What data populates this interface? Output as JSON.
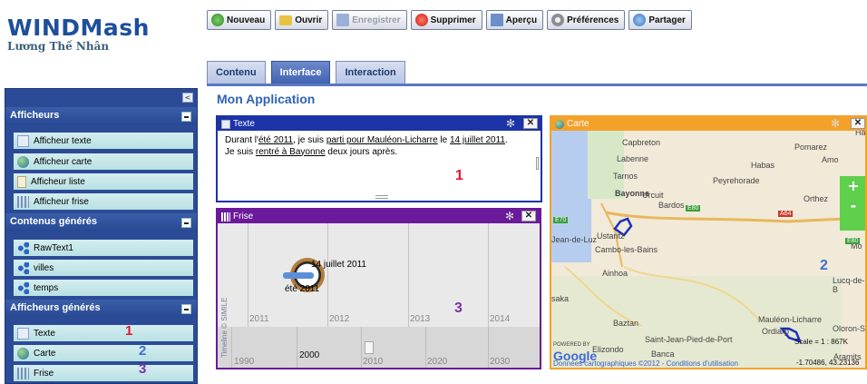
{
  "brand": {
    "title": "WINDMash",
    "author": "Lương Thế Nhân"
  },
  "toolbar": {
    "nouveau": "Nouveau",
    "ouvrir": "Ouvrir",
    "enregistrer": "Enregistrer",
    "supprimer": "Supprimer",
    "apercu": "Aperçu",
    "preferences": "Préférences",
    "partager": "Partager"
  },
  "tabs": [
    {
      "label": "Contenu"
    },
    {
      "label": "Interface"
    },
    {
      "label": "Interaction"
    }
  ],
  "sidebar": {
    "collapse_glyph": "<",
    "afficheurs": {
      "header": "Afficheurs",
      "items": [
        {
          "label": "Afficheur texte"
        },
        {
          "label": "Afficheur carte"
        },
        {
          "label": "Afficheur liste"
        },
        {
          "label": "Afficheur frise"
        }
      ]
    },
    "contenus": {
      "header": "Contenus générés",
      "items": [
        {
          "label": "RawText1"
        },
        {
          "label": "villes"
        },
        {
          "label": "temps"
        }
      ]
    },
    "generes": {
      "header": "Afficheurs générés",
      "items": [
        {
          "label": "Texte",
          "num": "1"
        },
        {
          "label": "Carte",
          "num": "2"
        },
        {
          "label": "Frise",
          "num": "3"
        }
      ]
    }
  },
  "main": {
    "title": "Mon Application"
  },
  "texte_panel": {
    "title": "Texte",
    "p1_a": "Durant l'",
    "p1_link1": "été 2011",
    "p1_b": ", je suis ",
    "p1_link2": "parti pour Mauléon-Licharre",
    "p1_c": " le ",
    "p1_link3": "14 juillet 2011",
    "p1_d": ".",
    "p2_a": "Je suis ",
    "p2_link": "rentré à Bayonne",
    "p2_b": " deux jours après.",
    "num": "1"
  },
  "frise_panel": {
    "title": "Frise",
    "event1": "14 juillet 2011",
    "event2": "été 2011",
    "years_top": [
      "2011",
      "2012",
      "2013",
      "2014"
    ],
    "years_bottom": [
      "1990",
      "2000",
      "2010",
      "2020",
      "2030"
    ],
    "credit": "Timeline © SIMILE",
    "num": "3"
  },
  "carte_panel": {
    "title": "Carte",
    "places": [
      "Capbreton",
      "Labenne",
      "Tarnos",
      "Bayonne",
      "Urcuit",
      "Bardos",
      "Habas",
      "Peyrehorade",
      "Pomarez",
      "Amo",
      "Ha",
      "Orthez",
      "Mo",
      "Ustaritz",
      "Cambo-les-Bains",
      "Jean-de-Luz",
      "Ainhoa",
      "saka",
      "Lucq-de-B",
      "Mauléon-Licharre",
      "Ordiarp",
      "Oloron-S",
      "Baztan",
      "Saint-Jean-Pied-de-Port",
      "Elizondo",
      "Banca",
      "Aramits"
    ],
    "routes": [
      "E70",
      "E80",
      "A64",
      "E80"
    ],
    "zoom_in": "+",
    "zoom_out": "-",
    "powered": "POWERED BY",
    "google": "Google",
    "scale": "Scale = 1 : 867K",
    "coords": "-1.70486, 43.23136",
    "attribution_a": "Données cartographiques ©2012 - ",
    "attribution_b": "Conditions d'utilisation",
    "num": "2"
  },
  "colors": {
    "accent": "#2d63b6",
    "texte": "#1c34a8",
    "frise": "#6a1a9a",
    "carte": "#f4a12a",
    "num1": "#e0182f",
    "num2": "#3f6fd0",
    "num3": "#7a33a6"
  }
}
